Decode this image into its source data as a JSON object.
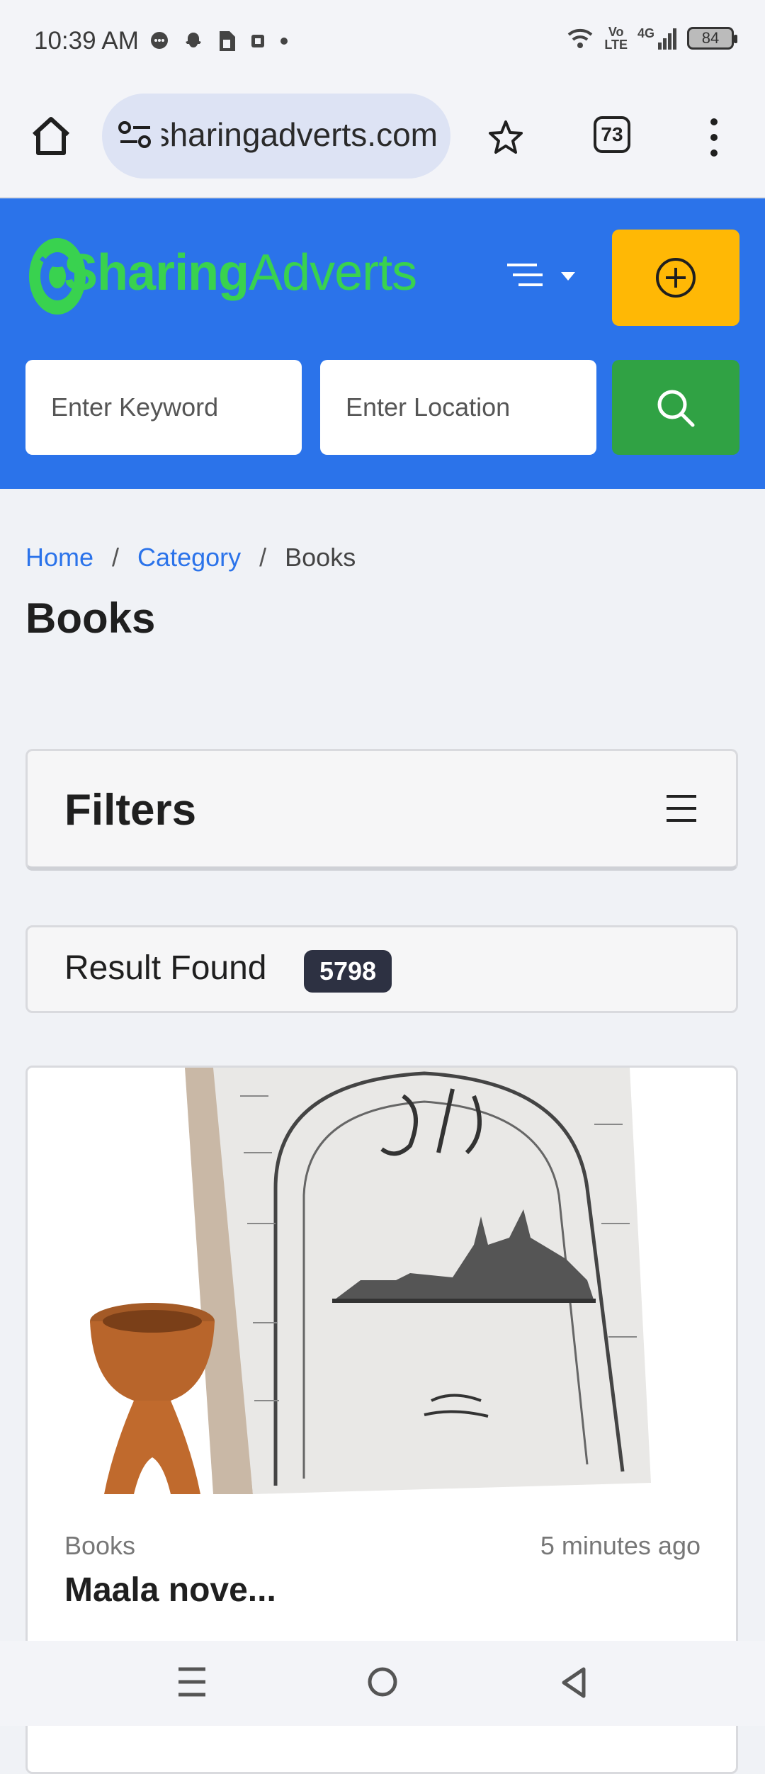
{
  "status_bar": {
    "time": "10:39 AM",
    "notification_icons": [
      "chat-icon",
      "snapchat-icon",
      "sim-icon",
      "nfc-icon",
      "dot-icon"
    ],
    "network_label_1": "Vo",
    "network_label_2": "LTE",
    "network_type": "4G",
    "battery": "84"
  },
  "browser": {
    "url": "sharingadverts.com",
    "tab_count": "73",
    "icons": [
      "home-icon",
      "site-settings-icon",
      "star-icon",
      "more-icon"
    ]
  },
  "header": {
    "brand_primary": "Sharing",
    "brand_secondary": "Adverts",
    "keyword_placeholder": "Enter Keyword",
    "location_placeholder": "Enter Location",
    "colors": {
      "header_bg": "#2b73ea",
      "add_button": "#ffb805",
      "search_button": "#30a244",
      "brand_green": "#39d24f"
    }
  },
  "breadcrumb": {
    "home": "Home",
    "category": "Category",
    "current": "Books"
  },
  "page_title": "Books",
  "filters": {
    "title": "Filters"
  },
  "results": {
    "label": "Result Found",
    "count": "5798"
  },
  "listing": {
    "category": "Books",
    "time": "5 minutes ago",
    "title": "Maala nove..."
  }
}
